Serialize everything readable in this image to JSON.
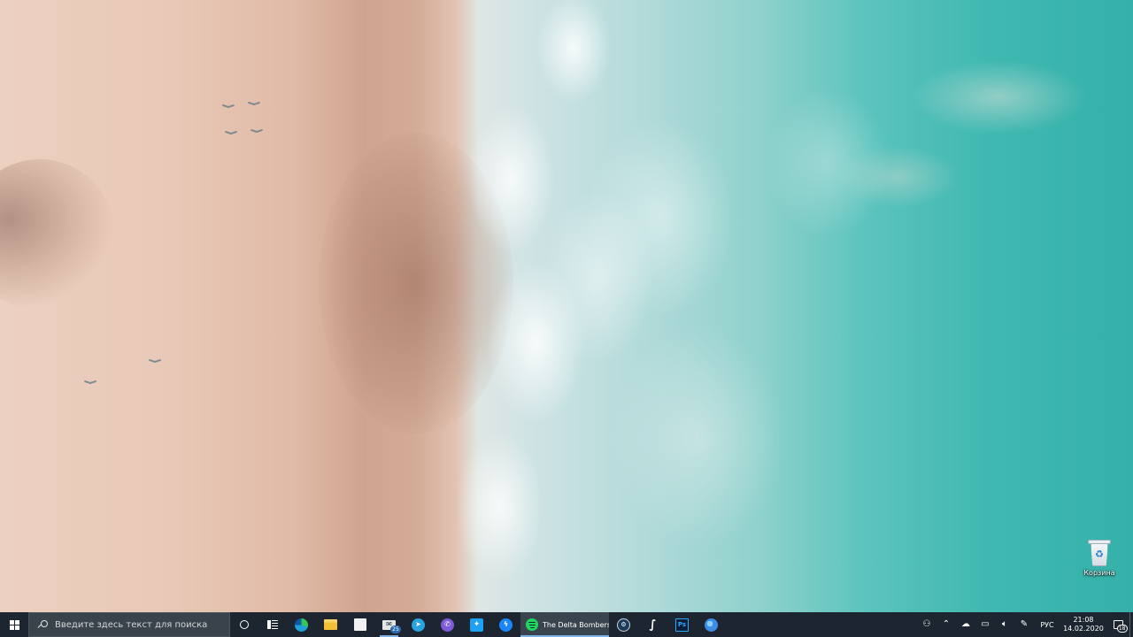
{
  "desktop": {
    "icons": [
      {
        "label": "Корзина",
        "icon": "recycle-bin-icon"
      }
    ]
  },
  "taskbar": {
    "start_icon": "windows-logo-icon",
    "search": {
      "placeholder": "Введите здесь текст для поиска",
      "icon": "search-icon"
    },
    "cortana_icon": "cortana-icon",
    "taskview_icon": "task-view-icon",
    "pinned": [
      {
        "name": "edge",
        "icon": "edge-icon",
        "color": "#1fa0d8"
      },
      {
        "name": "file-explorer",
        "icon": "folder-icon",
        "color": "#f2c037"
      },
      {
        "name": "store",
        "icon": "store-icon",
        "color": "#2f7fd6"
      },
      {
        "name": "mail",
        "icon": "mail-icon",
        "color": "#e6e6e6",
        "badge": "25"
      },
      {
        "name": "telegram",
        "icon": "telegram-icon",
        "color": "#2aa3df"
      },
      {
        "name": "viber",
        "icon": "viber-icon",
        "color": "#7d5bd8"
      },
      {
        "name": "twitter",
        "icon": "twitter-icon",
        "color": "#1da1f2"
      },
      {
        "name": "messenger",
        "icon": "messenger-icon",
        "color": "#1b86f7"
      }
    ],
    "spotify": {
      "label": "The Delta Bombers ...",
      "icon": "spotify-icon",
      "color": "#1ed760"
    },
    "pinned_after": [
      {
        "name": "steam",
        "icon": "steam-icon",
        "color": "#1b3a5c"
      },
      {
        "name": "app-connect",
        "icon": "connect-icon",
        "color": "#ffffff"
      },
      {
        "name": "photoshop",
        "icon": "photoshop-icon",
        "color": "#0b1e3a",
        "text": "Ps"
      },
      {
        "name": "app-circle",
        "icon": "circle-app-icon",
        "color": "#3b8ee8"
      }
    ],
    "tray": {
      "lang": "РУС",
      "time": "21:08",
      "date": "14.02.2020",
      "notifications_badge": "18"
    }
  }
}
